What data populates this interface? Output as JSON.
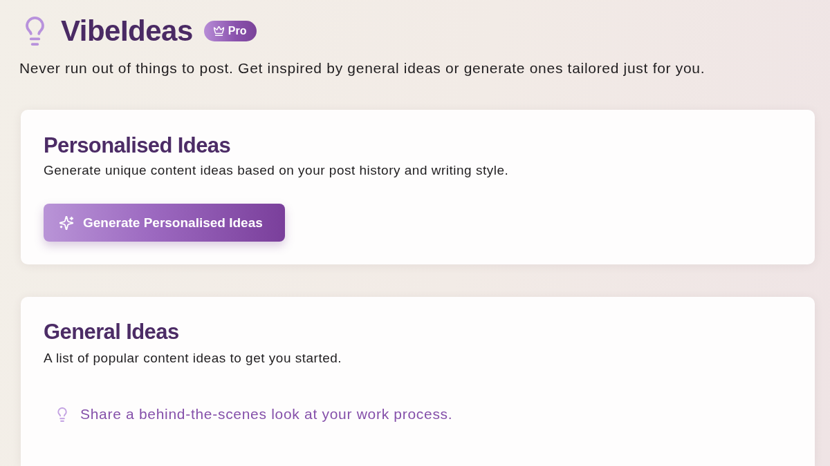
{
  "app": {
    "name": "VibeIdeas",
    "badge": "Pro",
    "tagline": "Never run out of things to post. Get inspired by general ideas or generate ones tailored just for you."
  },
  "personalised": {
    "title": "Personalised Ideas",
    "description": "Generate unique content ideas based on your post history and writing style.",
    "button": "Generate Personalised Ideas"
  },
  "general": {
    "title": "General Ideas",
    "description": "A list of popular content ideas to get you started.",
    "ideas": [
      "Share a behind-the-scenes look at your work process."
    ]
  }
}
